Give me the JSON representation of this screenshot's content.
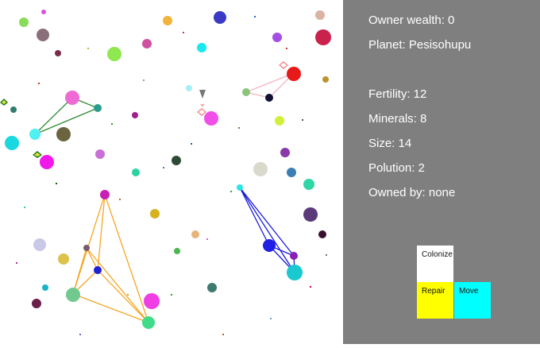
{
  "panel": {
    "owner_wealth": "Owner wealth: 0",
    "planet": "Planet: Pesisohupu",
    "fertility": "Fertility: 12",
    "minerals": "Minerals: 8",
    "size": "Size: 14",
    "pollution": "Polution: 2",
    "owned_by": "Owned by: none"
  },
  "buttons": {
    "colonize": "Colonize",
    "repair": "Repair",
    "move": "Move"
  },
  "colors": {
    "panel_background": "#7f7f7f",
    "colonize_button": "#ffffff",
    "repair_button": "#ffff00",
    "move_button": "#00ffff",
    "route_green": "#2e8b2e",
    "route_pink": "#f4b6c2",
    "route_orange": "#f5a623",
    "route_blue": "#1c1cdc"
  }
}
